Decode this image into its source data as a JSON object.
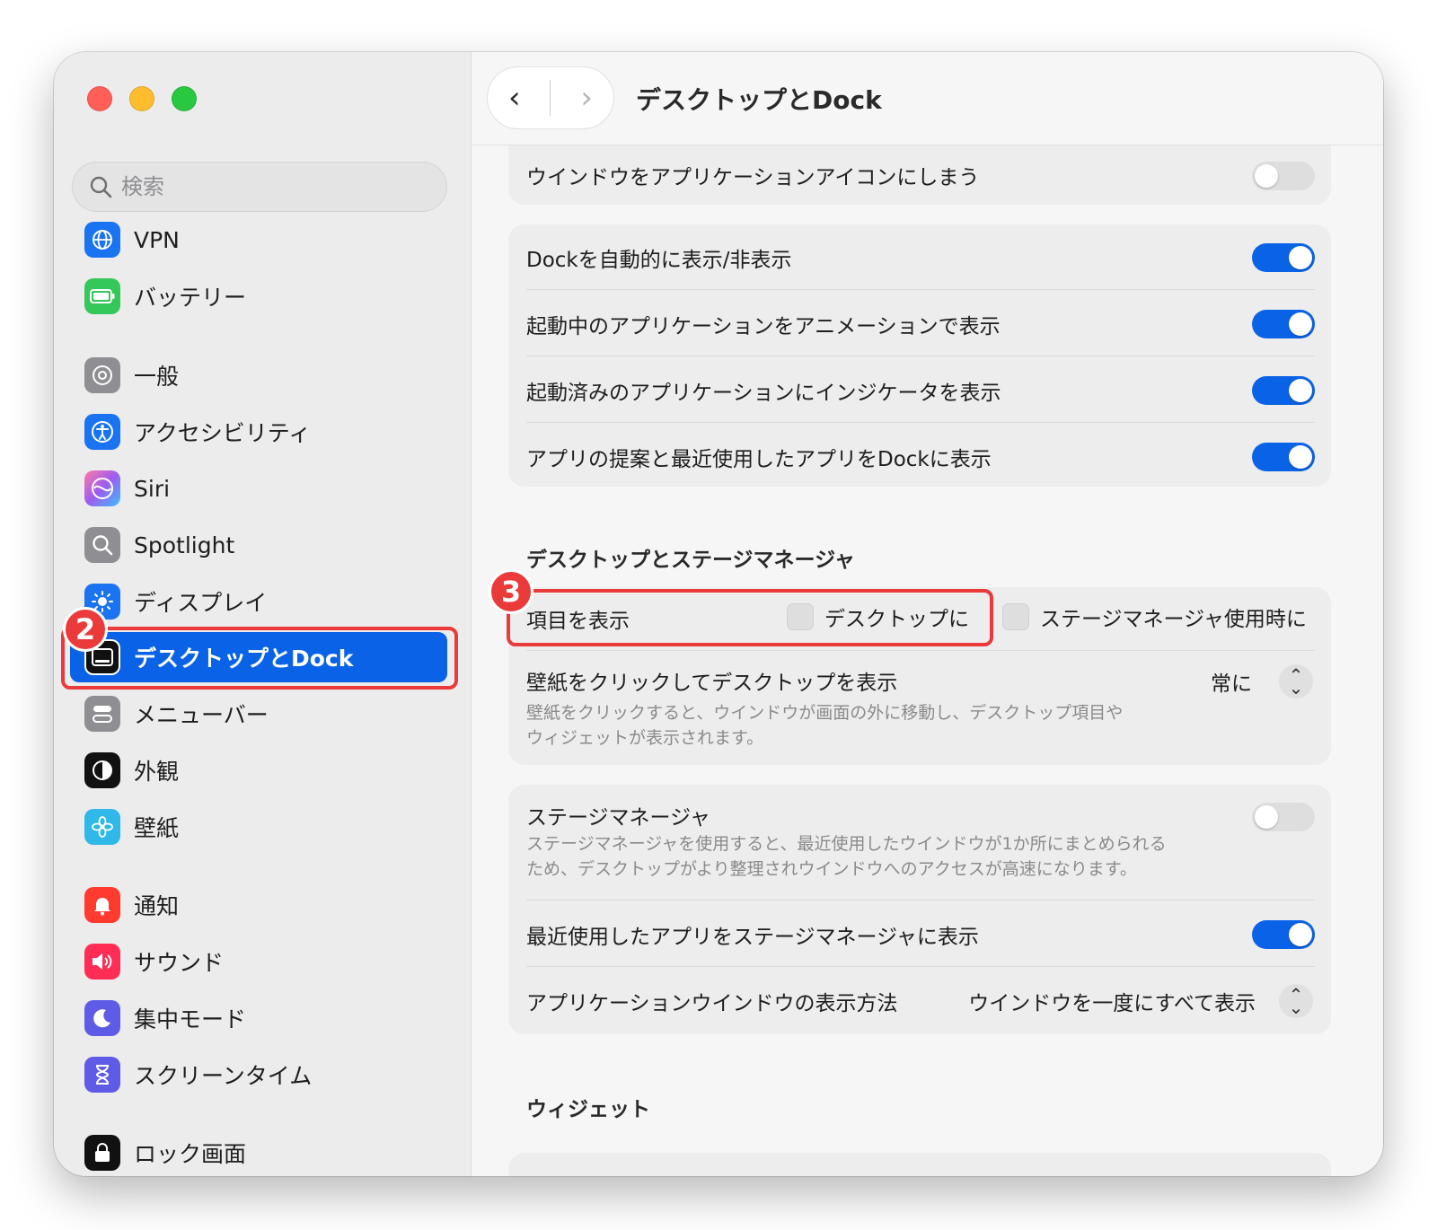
{
  "window": {
    "title": "デスクトップとDock"
  },
  "search": {
    "placeholder": "検索"
  },
  "sidebar": {
    "items": [
      {
        "label": "VPN",
        "icon": "globe-icon",
        "color": "#1a73f0"
      },
      {
        "label": "バッテリー",
        "icon": "battery-icon",
        "color": "#34c759"
      },
      {
        "label": "一般",
        "icon": "gear-icon",
        "color": "#8e8e93"
      },
      {
        "label": "アクセシビリティ",
        "icon": "accessibility-icon",
        "color": "#1a73f0"
      },
      {
        "label": "Siri",
        "icon": "siri-icon",
        "color": "#d65ad6"
      },
      {
        "label": "Spotlight",
        "icon": "magnifier-icon",
        "color": "#8e8e93"
      },
      {
        "label": "ディスプレイ",
        "icon": "sun-icon",
        "color": "#1a73f0"
      },
      {
        "label": "デスクトップとDock",
        "icon": "dock-icon",
        "color": "#111111"
      },
      {
        "label": "メニューバー",
        "icon": "menubar-icon",
        "color": "#8e8e93"
      },
      {
        "label": "外観",
        "icon": "appearance-icon",
        "color": "#111111"
      },
      {
        "label": "壁紙",
        "icon": "flower-icon",
        "color": "#2fb8e8"
      },
      {
        "label": "通知",
        "icon": "bell-icon",
        "color": "#ff3b30"
      },
      {
        "label": "サウンド",
        "icon": "speaker-icon",
        "color": "#ff2d55"
      },
      {
        "label": "集中モード",
        "icon": "moon-icon",
        "color": "#5e5ce6"
      },
      {
        "label": "スクリーンタイム",
        "icon": "hourglass-icon",
        "color": "#5e5ce6"
      },
      {
        "label": "ロック画面",
        "icon": "lock-icon",
        "color": "#111111"
      }
    ]
  },
  "nav": {
    "back": "‹",
    "forward": "›"
  },
  "main": {
    "row_minimize_icon": "ウインドウをアプリケーションアイコンにしまう",
    "dock_rows": [
      "Dockを自動的に表示/非表示",
      "起動中のアプリケーションをアニメーションで表示",
      "起動済みのアプリケーションにインジケータを表示",
      "アプリの提案と最近使用したアプリをDockに表示"
    ],
    "section_desktop": "デスクトップとステージマネージャ",
    "show_items_label": "項目を表示",
    "show_items_desktop": "デスクトップに",
    "show_items_stage": "ステージマネージャ使用時に",
    "wallpaper_click_label": "壁紙をクリックしてデスクトップを表示",
    "wallpaper_click_value": "常に",
    "wallpaper_click_desc_1": "壁紙をクリックすると、ウインドウが画面の外に移動し、デスクトップ項目や",
    "wallpaper_click_desc_2": "ウィジェットが表示されます。",
    "stage_manager_label": "ステージマネージャ",
    "stage_manager_desc_1": "ステージマネージャを使用すると、最近使用したウインドウが1か所にまとめられる",
    "stage_manager_desc_2": "ため、デスクトップがより整理されウインドウへのアクセスが高速になります。",
    "recent_apps_stage": "最近使用したアプリをステージマネージャに表示",
    "app_window_label": "アプリケーションウインドウの表示方法",
    "app_window_value": "ウインドウを一度にすべて表示",
    "section_widgets": "ウィジェット"
  },
  "annotations": {
    "step2": "2",
    "step3": "3"
  },
  "colors": {
    "accent": "#0a63e6",
    "annotation": "#ea3a3a"
  }
}
